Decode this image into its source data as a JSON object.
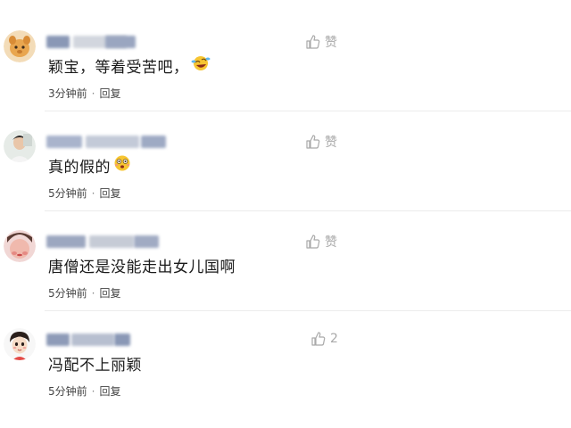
{
  "comments": [
    {
      "like_label": "赞",
      "like_count": "",
      "text": "颖宝，等着受苦吧，",
      "emoji": "laughing-crying-emoji",
      "time": "3分钟前",
      "reply_label": "回复",
      "avatar": "orange-animal-avatar"
    },
    {
      "like_label": "赞",
      "like_count": "",
      "text": "真的假的",
      "emoji": "surprised-emoji",
      "time": "5分钟前",
      "reply_label": "回复",
      "avatar": "person-photo-avatar"
    },
    {
      "like_label": "赞",
      "like_count": "",
      "text": "唐僧还是没能走出女儿国啊",
      "emoji": "",
      "time": "5分钟前",
      "reply_label": "回复",
      "avatar": "face-photo-avatar"
    },
    {
      "like_label": "",
      "like_count": "2",
      "text": "冯配不上丽颖",
      "emoji": "",
      "time": "5分钟前",
      "reply_label": "回复",
      "avatar": "cartoon-person-avatar"
    }
  ],
  "colors": {
    "icon_gray": "#a9a9a9",
    "text": "#1a1a1a",
    "meta": "#444444"
  }
}
